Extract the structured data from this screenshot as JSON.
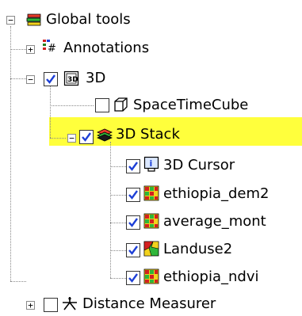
{
  "tree": {
    "root": {
      "label": "Global tools",
      "expander": "−"
    },
    "annotations": {
      "label": "Annotations",
      "expander": "+"
    },
    "group_3d": {
      "label": "3D",
      "expander": "−",
      "checked": true
    },
    "space_time_cube": {
      "label": "SpaceTimeCube",
      "checked": false
    },
    "stack_3d": {
      "label": "3D Stack",
      "expander": "−",
      "checked": true,
      "highlight_color": "#ffff3c"
    },
    "cursor_3d": {
      "label": "3D Cursor",
      "checked": true
    },
    "ethiopia_dem": {
      "label": "ethiopia_dem2",
      "checked": true
    },
    "average_mont": {
      "label": "average_mont",
      "checked": true
    },
    "landuse2": {
      "label": "Landuse2",
      "checked": true
    },
    "ethiopia_ndvi": {
      "label": "ethiopia_ndvi",
      "checked": true
    },
    "distance_measurer": {
      "label": "Distance Measurer",
      "expander": "+",
      "checked": false
    }
  },
  "colors": {
    "checkmark": "#1d3fd6",
    "highlight": "#ffff3c",
    "dotted_line": "#888888"
  }
}
